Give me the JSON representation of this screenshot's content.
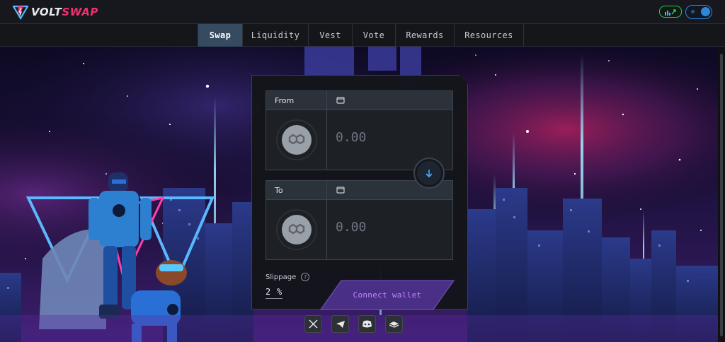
{
  "brand": {
    "part1": "VOLT",
    "part2": "SWAP",
    "accent": "#f0306e"
  },
  "header": {
    "stats_icon": "chart-trend-icon",
    "theme_icon": "moon-icon"
  },
  "nav": {
    "items": [
      {
        "label": "Swap",
        "active": true
      },
      {
        "label": "Liquidity",
        "active": false
      },
      {
        "label": "Vest",
        "active": false
      },
      {
        "label": "Vote",
        "active": false
      },
      {
        "label": "Rewards",
        "active": false
      },
      {
        "label": "Resources",
        "active": false
      }
    ]
  },
  "swap": {
    "from": {
      "label": "From",
      "placeholder": "0.00",
      "token_icon": "polygon-icon",
      "wallet_icon": "wallet-icon"
    },
    "to": {
      "label": "To",
      "placeholder": "0.00",
      "token_icon": "polygon-icon",
      "wallet_icon": "wallet-icon"
    },
    "flip_icon": "arrow-down-icon",
    "slippage": {
      "label": "Slippage",
      "help": "?",
      "value": "2",
      "unit": "%"
    },
    "connect_label": "Connect wallet"
  },
  "socials": [
    {
      "name": "x-icon"
    },
    {
      "name": "telegram-icon"
    },
    {
      "name": "discord-icon"
    },
    {
      "name": "docs-icon"
    }
  ],
  "colors": {
    "nav_active": "#364a60",
    "connect_text": "#b98bff",
    "connect_fill": "#4a2f86",
    "panel_bg": "#14161a",
    "box_header": "#2b3239"
  }
}
